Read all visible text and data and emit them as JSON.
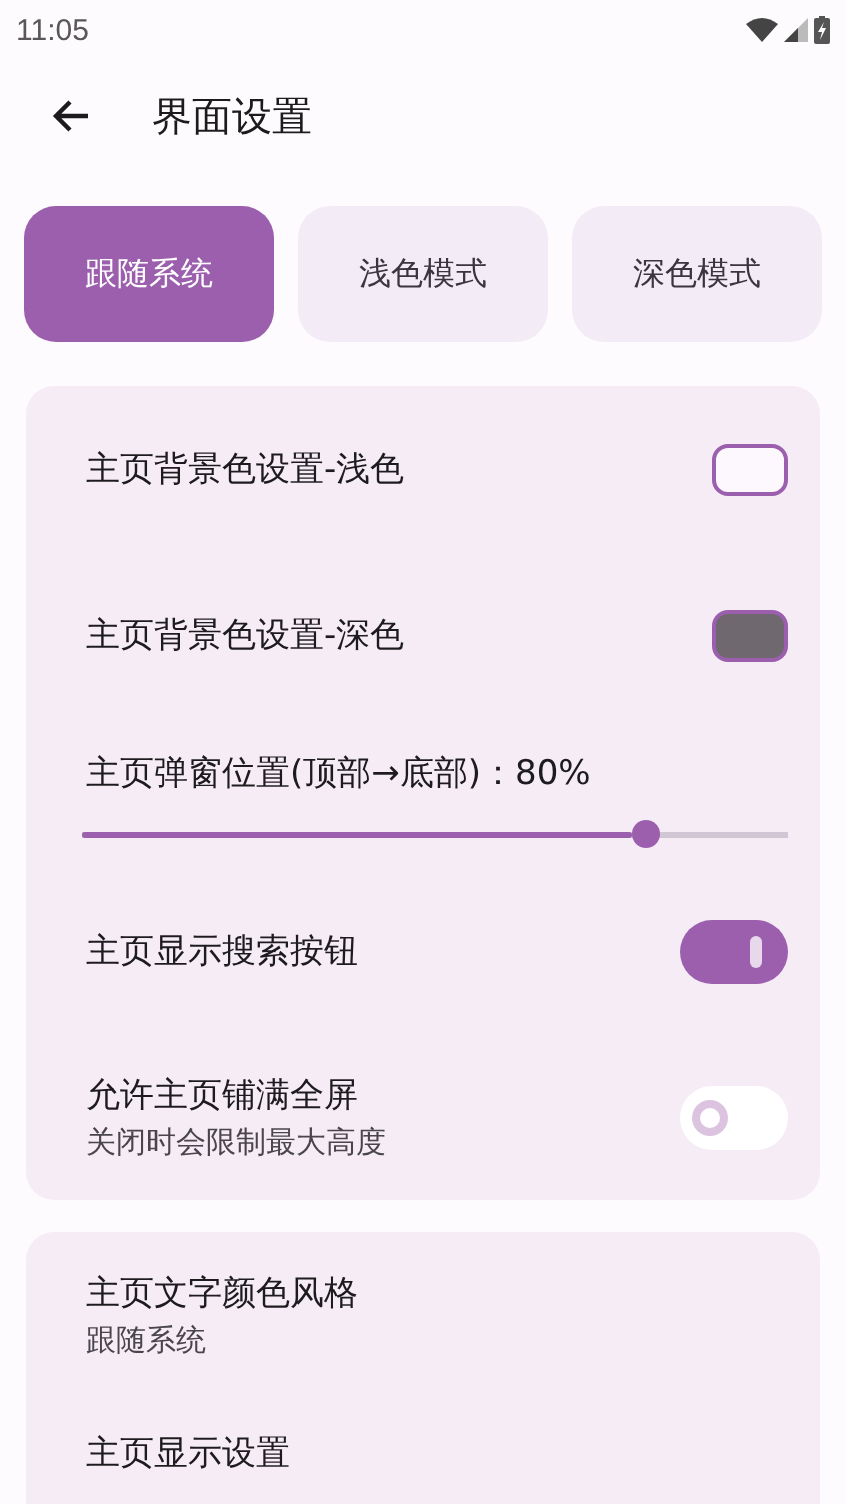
{
  "status_bar": {
    "time": "11:05"
  },
  "header": {
    "title": "界面设置"
  },
  "tabs": [
    {
      "label": "跟随系统",
      "selected": true
    },
    {
      "label": "浅色模式",
      "selected": false
    },
    {
      "label": "深色模式",
      "selected": false
    }
  ],
  "cards": [
    {
      "items": [
        {
          "kind": "swatch",
          "label": "主页背景色设置-浅色",
          "color": "#fdf8fd"
        },
        {
          "kind": "swatch",
          "label": "主页背景色设置-深色",
          "color": "#6f686e"
        },
        {
          "kind": "slider",
          "label": "主页弹窗位置(顶部→底部)：80%",
          "level": 0.8
        },
        {
          "kind": "switch",
          "label": "主页显示搜索按钮",
          "on": true
        },
        {
          "kind": "switch",
          "label": "允许主页铺满全屏",
          "subtitle": "关闭时会限制最大高度",
          "on": false
        }
      ]
    },
    {
      "items": [
        {
          "kind": "text",
          "label": "主页文字颜色风格",
          "subtitle": "跟随系统"
        },
        {
          "kind": "text",
          "label": "主页显示设置"
        }
      ]
    }
  ]
}
